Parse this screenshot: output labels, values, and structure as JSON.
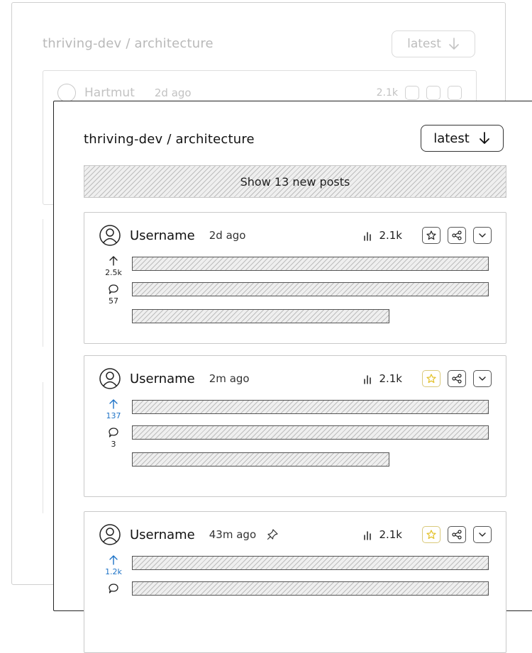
{
  "background_panel": {
    "title": "thriving-dev / architecture",
    "sort_label": "latest",
    "first_card": {
      "username": "Hartmut",
      "time": "2d ago",
      "views": "2.1k"
    }
  },
  "header": {
    "title": "thriving-dev / architecture",
    "sort_label": "latest",
    "sort_icon": "arrow-down-icon"
  },
  "new_posts_banner": "Show 13 new posts",
  "posts": [
    {
      "username": "Username",
      "time": "2d ago",
      "pinned": false,
      "views": "2.1k",
      "starred": false,
      "upvoted": false,
      "votes": "2.5k",
      "comments": "57"
    },
    {
      "username": "Username",
      "time": "2m ago",
      "pinned": false,
      "views": "2.1k",
      "starred": true,
      "upvoted": true,
      "votes": "137",
      "comments": "3"
    },
    {
      "username": "Username",
      "time": "43m ago",
      "pinned": true,
      "views": "2.1k",
      "starred": true,
      "upvoted": true,
      "votes": "1.2k",
      "comments": ""
    }
  ],
  "colors": {
    "accent": "#1e73c7",
    "star": "#e3c024",
    "text": "#111111",
    "hatch": "#bdbdbd"
  }
}
